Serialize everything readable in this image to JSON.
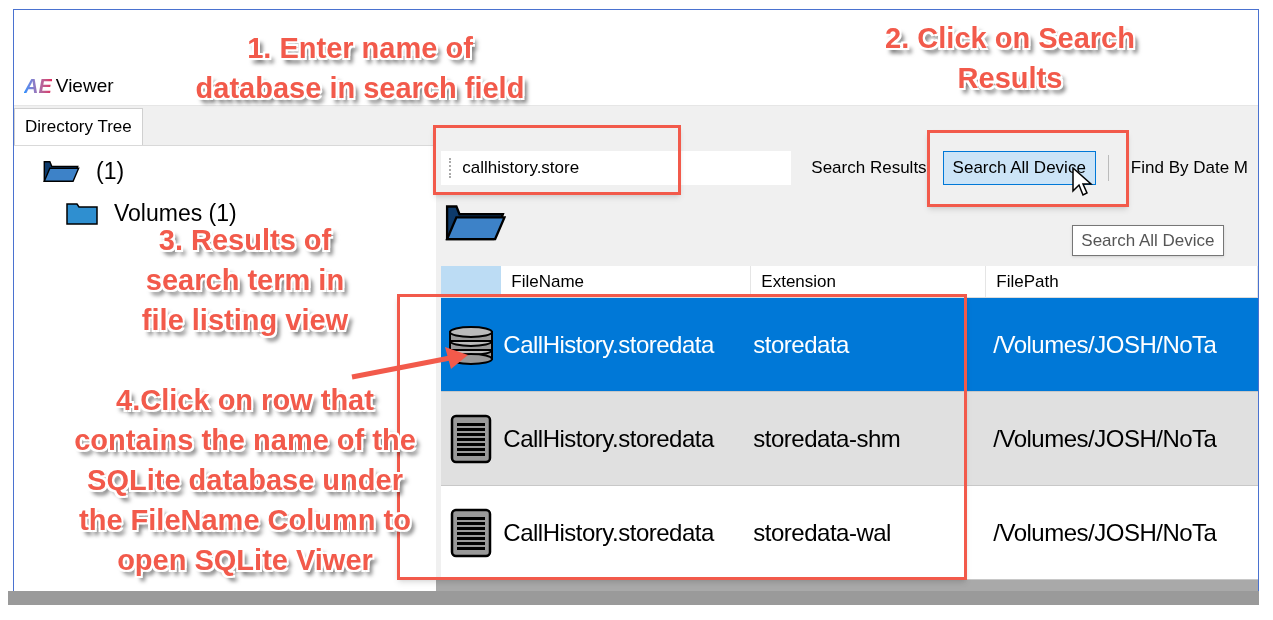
{
  "window": {
    "logo": "AE",
    "title": "Viewer"
  },
  "left_tab": {
    "label": "Directory Tree",
    "selected": true
  },
  "tree": [
    {
      "label": "(1)",
      "expanded": true,
      "children": [
        {
          "label": "Volumes (1)",
          "expanded": false
        }
      ]
    }
  ],
  "search": {
    "value": "callhistory.store"
  },
  "toolbar": [
    {
      "label": "Search Results",
      "selected": false
    },
    {
      "label": "Search All Device",
      "selected": true
    },
    {
      "label": "Find By Date M",
      "selected": false
    }
  ],
  "tooltip": "Search All Device",
  "table": {
    "columns": [
      "FileName",
      "Extension",
      "FilePath"
    ],
    "rows": [
      {
        "kind": "database",
        "selected": true,
        "hovered": false,
        "cells": [
          "CallHistory.storedata",
          "storedata",
          "/Volumes/JOSH/NoTa"
        ]
      },
      {
        "kind": "file",
        "selected": false,
        "hovered": true,
        "cells": [
          "CallHistory.storedata",
          "storedata-shm",
          "/Volumes/JOSH/NoTa"
        ]
      },
      {
        "kind": "file",
        "selected": false,
        "hovered": false,
        "cells": [
          "CallHistory.storedata",
          "storedata-wal",
          "/Volumes/JOSH/NoTa"
        ]
      }
    ]
  },
  "annotations": [
    "1. Enter name of\ndatabase in search field",
    "2. Click on Search\nResults",
    "3. Results of\nsearch term in\nfile listing view",
    "4.Click on row that\ncontains the name of the\nSQLite database under\nthe FileName Column to\nopen SQLite Viwer"
  ]
}
